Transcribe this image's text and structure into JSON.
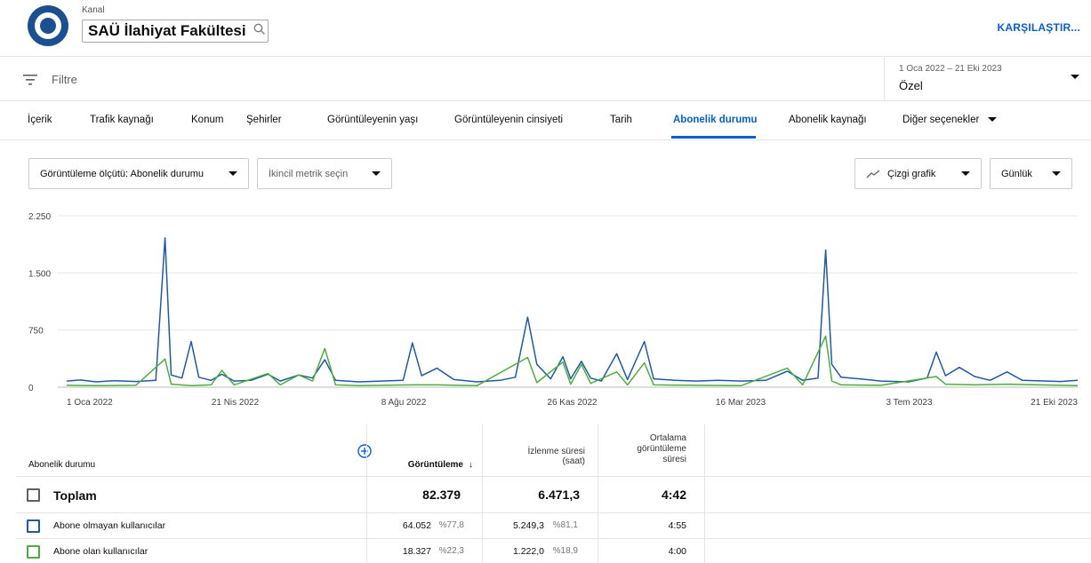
{
  "header": {
    "channel_label": "Kanal",
    "channel_name": "SAÜ İlahiyat Fakültesi",
    "compare_label": "KARŞILAŞTIR..."
  },
  "filter": {
    "placeholder": "Filtre"
  },
  "date": {
    "range": "1 Oca 2022 – 21 Eki 2023",
    "preset": "Özel"
  },
  "tabs": [
    {
      "label": "İçerik"
    },
    {
      "label": "Trafik kaynağı"
    },
    {
      "label": "Konum"
    },
    {
      "label": "Şehirler"
    },
    {
      "label": "Görüntüleyenin yaşı"
    },
    {
      "label": "Görüntüleyenin cinsiyeti"
    },
    {
      "label": "Tarih"
    },
    {
      "label": "Abonelik durumu"
    },
    {
      "label": "Abonelik kaynağı"
    },
    {
      "label": "Diğer seçenekler"
    }
  ],
  "active_tab": 7,
  "controls": {
    "view_by": "Görüntüleme ölçütü: Abonelik durumu",
    "secondary_metric": "İkincil metrik seçin",
    "chart_type": "Çizgi grafik",
    "granularity": "Günlük"
  },
  "colors": {
    "accent": "#065fd4",
    "series_nonsub": "#1f5aa6",
    "series_sub": "#4caf3c"
  },
  "chart_data": {
    "type": "line",
    "x_range": [
      "2022-01-01",
      "2023-10-21"
    ],
    "xticks": [
      "1 Oca 2022",
      "21 Nis 2022",
      "8 Ağu 2022",
      "26 Kas 2022",
      "16 Mar 2023",
      "3 Tem 2023",
      "21 Eki 2023"
    ],
    "yticks": [
      "0",
      "750",
      "1.500",
      "2.250"
    ],
    "ylim": [
      0,
      2250
    ],
    "grid": true,
    "series": [
      {
        "name": "Abone olmayan kullanıcılar",
        "color": "#1f5aa6",
        "points": [
          [
            "2022-01-01",
            80
          ],
          [
            "2022-01-10",
            95
          ],
          [
            "2022-01-20",
            70
          ],
          [
            "2022-02-01",
            85
          ],
          [
            "2022-02-15",
            75
          ],
          [
            "2022-02-28",
            90
          ],
          [
            "2022-03-06",
            1960
          ],
          [
            "2022-03-10",
            160
          ],
          [
            "2022-03-17",
            120
          ],
          [
            "2022-03-23",
            600
          ],
          [
            "2022-03-28",
            130
          ],
          [
            "2022-04-05",
            90
          ],
          [
            "2022-04-12",
            170
          ],
          [
            "2022-04-20",
            80
          ],
          [
            "2022-05-01",
            90
          ],
          [
            "2022-05-12",
            170
          ],
          [
            "2022-05-20",
            80
          ],
          [
            "2022-06-01",
            160
          ],
          [
            "2022-06-10",
            120
          ],
          [
            "2022-06-18",
            360
          ],
          [
            "2022-06-25",
            90
          ],
          [
            "2022-07-10",
            70
          ],
          [
            "2022-07-25",
            80
          ],
          [
            "2022-08-08",
            90
          ],
          [
            "2022-08-14",
            580
          ],
          [
            "2022-08-20",
            150
          ],
          [
            "2022-08-30",
            250
          ],
          [
            "2022-09-10",
            100
          ],
          [
            "2022-09-25",
            70
          ],
          [
            "2022-10-10",
            90
          ],
          [
            "2022-10-20",
            130
          ],
          [
            "2022-10-28",
            920
          ],
          [
            "2022-11-03",
            300
          ],
          [
            "2022-11-12",
            110
          ],
          [
            "2022-11-20",
            400
          ],
          [
            "2022-11-25",
            110
          ],
          [
            "2022-12-02",
            340
          ],
          [
            "2022-12-08",
            120
          ],
          [
            "2022-12-15",
            80
          ],
          [
            "2022-12-25",
            440
          ],
          [
            "2023-01-01",
            100
          ],
          [
            "2023-01-12",
            600
          ],
          [
            "2023-01-18",
            110
          ],
          [
            "2023-02-01",
            90
          ],
          [
            "2023-02-15",
            80
          ],
          [
            "2023-03-01",
            90
          ],
          [
            "2023-03-16",
            80
          ],
          [
            "2023-04-01",
            90
          ],
          [
            "2023-04-15",
            210
          ],
          [
            "2023-04-25",
            90
          ],
          [
            "2023-05-05",
            120
          ],
          [
            "2023-05-10",
            1800
          ],
          [
            "2023-05-14",
            300
          ],
          [
            "2023-05-20",
            130
          ],
          [
            "2023-06-01",
            110
          ],
          [
            "2023-06-15",
            80
          ],
          [
            "2023-07-03",
            70
          ],
          [
            "2023-07-15",
            120
          ],
          [
            "2023-07-21",
            460
          ],
          [
            "2023-07-27",
            150
          ],
          [
            "2023-08-05",
            260
          ],
          [
            "2023-08-15",
            140
          ],
          [
            "2023-08-25",
            90
          ],
          [
            "2023-09-05",
            200
          ],
          [
            "2023-09-15",
            90
          ],
          [
            "2023-10-01",
            80
          ],
          [
            "2023-10-10",
            75
          ],
          [
            "2023-10-21",
            90
          ]
        ]
      },
      {
        "name": "Abone olan kullanıcılar",
        "color": "#4caf3c",
        "points": [
          [
            "2022-01-01",
            25
          ],
          [
            "2022-01-20",
            20
          ],
          [
            "2022-02-15",
            25
          ],
          [
            "2022-03-06",
            370
          ],
          [
            "2022-03-10",
            40
          ],
          [
            "2022-03-23",
            20
          ],
          [
            "2022-04-05",
            30
          ],
          [
            "2022-04-12",
            220
          ],
          [
            "2022-04-20",
            30
          ],
          [
            "2022-05-12",
            180
          ],
          [
            "2022-05-20",
            30
          ],
          [
            "2022-06-01",
            160
          ],
          [
            "2022-06-10",
            80
          ],
          [
            "2022-06-18",
            510
          ],
          [
            "2022-06-25",
            30
          ],
          [
            "2022-07-10",
            20
          ],
          [
            "2022-08-14",
            30
          ],
          [
            "2022-08-30",
            30
          ],
          [
            "2022-09-25",
            20
          ],
          [
            "2022-10-28",
            390
          ],
          [
            "2022-11-03",
            60
          ],
          [
            "2022-11-20",
            330
          ],
          [
            "2022-11-25",
            40
          ],
          [
            "2022-12-02",
            300
          ],
          [
            "2022-12-08",
            50
          ],
          [
            "2022-12-25",
            200
          ],
          [
            "2023-01-01",
            30
          ],
          [
            "2023-01-12",
            320
          ],
          [
            "2023-01-18",
            30
          ],
          [
            "2023-02-15",
            25
          ],
          [
            "2023-03-16",
            20
          ],
          [
            "2023-04-15",
            250
          ],
          [
            "2023-04-25",
            30
          ],
          [
            "2023-05-10",
            670
          ],
          [
            "2023-05-14",
            80
          ],
          [
            "2023-05-20",
            30
          ],
          [
            "2023-06-15",
            25
          ],
          [
            "2023-07-21",
            140
          ],
          [
            "2023-07-27",
            40
          ],
          [
            "2023-08-15",
            30
          ],
          [
            "2023-09-05",
            40
          ],
          [
            "2023-10-21",
            20
          ]
        ]
      }
    ]
  },
  "table": {
    "headers": {
      "dimension": "Abonelik durumu",
      "views": "Görüntüleme",
      "watch_time_1": "İzlenme süresi",
      "watch_time_2": "(saat)",
      "avg_1": "Ortalama",
      "avg_2": "görüntüleme",
      "avg_3": "süresi"
    },
    "total": {
      "label": "Toplam",
      "views": "82.379",
      "watch_time": "6.471,3",
      "avg": "4:42"
    },
    "rows": [
      {
        "label": "Abone olmayan kullanıcılar",
        "views": "64.052",
        "views_pct": "%77,8",
        "watch_time": "5.249,3",
        "watch_pct": "%81,1",
        "avg": "4:55",
        "color": "#1f5aa6"
      },
      {
        "label": "Abone olan kullanıcılar",
        "views": "18.327",
        "views_pct": "%22,3",
        "watch_time": "1.222,0",
        "watch_pct": "%18,9",
        "avg": "4:00",
        "color": "#4caf3c"
      }
    ]
  }
}
